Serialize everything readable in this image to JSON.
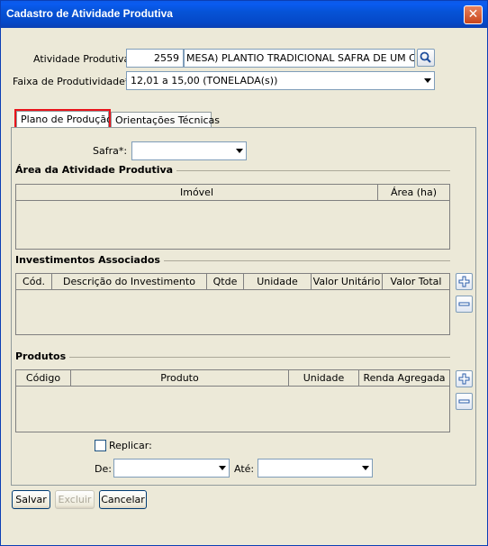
{
  "window": {
    "title": "Cadastro de Atividade Produtiva",
    "close_glyph": "✕"
  },
  "form": {
    "atividade_label": "Atividade Produtiva:",
    "atividade_code": "2559",
    "atividade_desc": "MESA) PLANTIO TRADICIONAL SAFRA DE UM CICLO",
    "faixa_label": "Faixa de Produtividade*:",
    "faixa_value": "12,01 a 15,00 (TONELADA(s))"
  },
  "tabs": [
    {
      "label": "Plano de Produção",
      "active": true
    },
    {
      "label": "Orientações Técnicas",
      "active": false
    }
  ],
  "safra": {
    "label": "Safra*:",
    "value": ""
  },
  "area": {
    "title": "Área da Atividade Produtiva",
    "columns": [
      "Imóvel",
      "Área (ha)"
    ]
  },
  "investimentos": {
    "title": "Investimentos Associados",
    "columns": [
      "Cód.",
      "Descrição do Investimento",
      "Qtde",
      "Unidade",
      "Valor Unitário",
      "Valor Total"
    ]
  },
  "produtos": {
    "title": "Produtos",
    "columns": [
      "Código",
      "Produto",
      "Unidade",
      "Renda Agregada"
    ]
  },
  "replicar": {
    "label": "Replicar:",
    "de_label": "De:",
    "ate_label": "Até:",
    "de_value": "",
    "ate_value": ""
  },
  "buttons": {
    "salvar": "Salvar",
    "excluir": "Excluir",
    "cancelar": "Cancelar"
  },
  "colors": {
    "highlight": "#e8141c",
    "titlebar": "#0653d6"
  }
}
